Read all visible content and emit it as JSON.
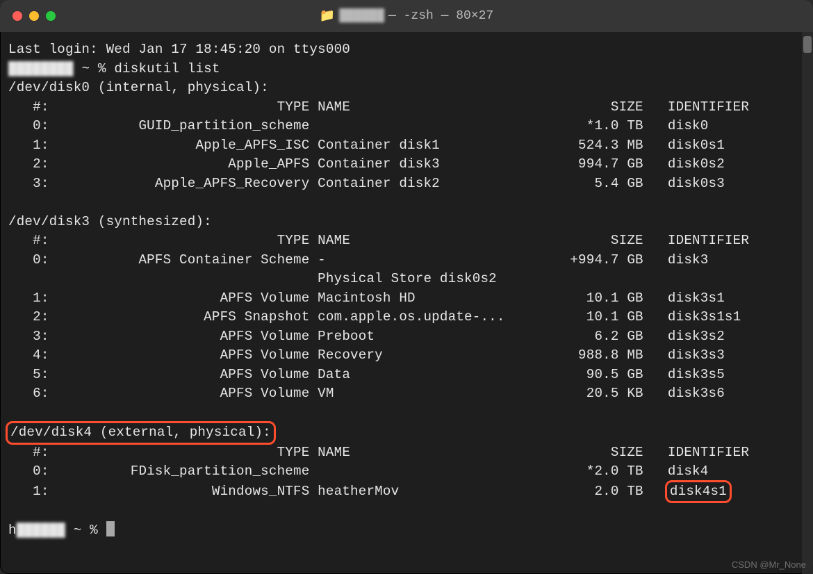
{
  "title": {
    "host_hidden": "██████",
    "suffix": "— -zsh — 80×27"
  },
  "login_line": "Last login: Wed Jan 17 18:45:20 on ttys000",
  "prompt1_user_hidden": "████████",
  "prompt1_path": "~ %",
  "command": "diskutil list",
  "disks": [
    {
      "header": "/dev/disk0 (internal, physical):",
      "highlight": false,
      "cols": {
        "idx": "   #:",
        "type": "TYPE",
        "name": "NAME",
        "size": "SIZE",
        "id": "IDENTIFIER"
      },
      "rows": [
        {
          "idx": "   0:",
          "type": "GUID_partition_scheme",
          "name": "",
          "size": "*1.0 TB",
          "id": "disk0"
        },
        {
          "idx": "   1:",
          "type": "Apple_APFS_ISC",
          "name": "Container disk1",
          "size": "524.3 MB",
          "id": "disk0s1"
        },
        {
          "idx": "   2:",
          "type": "Apple_APFS",
          "name": "Container disk3",
          "size": "994.7 GB",
          "id": "disk0s2"
        },
        {
          "idx": "   3:",
          "type": "Apple_APFS_Recovery",
          "name": "Container disk2",
          "size": "5.4 GB",
          "id": "disk0s3"
        }
      ]
    },
    {
      "header": "/dev/disk3 (synthesized):",
      "highlight": false,
      "cols": {
        "idx": "   #:",
        "type": "TYPE",
        "name": "NAME",
        "size": "SIZE",
        "id": "IDENTIFIER"
      },
      "rows": [
        {
          "idx": "   0:",
          "type": "APFS Container Scheme",
          "name": "-",
          "size": "+994.7 GB",
          "id": "disk3"
        },
        {
          "idx": "",
          "type": "",
          "name": "Physical Store disk0s2",
          "size": "",
          "id": ""
        },
        {
          "idx": "   1:",
          "type": "APFS Volume",
          "name": "Macintosh HD",
          "size": "10.1 GB",
          "id": "disk3s1"
        },
        {
          "idx": "   2:",
          "type": "APFS Snapshot",
          "name": "com.apple.os.update-...",
          "size": "10.1 GB",
          "id": "disk3s1s1"
        },
        {
          "idx": "   3:",
          "type": "APFS Volume",
          "name": "Preboot",
          "size": "6.2 GB",
          "id": "disk3s2"
        },
        {
          "idx": "   4:",
          "type": "APFS Volume",
          "name": "Recovery",
          "size": "988.8 MB",
          "id": "disk3s3"
        },
        {
          "idx": "   5:",
          "type": "APFS Volume",
          "name": "Data",
          "size": "90.5 GB",
          "id": "disk3s5"
        },
        {
          "idx": "   6:",
          "type": "APFS Volume",
          "name": "VM",
          "size": "20.5 KB",
          "id": "disk3s6"
        }
      ]
    },
    {
      "header": "/dev/disk4 (external, physical):",
      "highlight": true,
      "cols": {
        "idx": "   #:",
        "type": "TYPE",
        "name": "NAME",
        "size": "SIZE",
        "id": "IDENTIFIER"
      },
      "rows": [
        {
          "idx": "   0:",
          "type": "FDisk_partition_scheme",
          "name": "",
          "size": "*2.0 TB",
          "id": "disk4"
        },
        {
          "idx": "   1:",
          "type": "Windows_NTFS",
          "name": "heatherMov",
          "size": "2.0 TB",
          "id": "disk4s1",
          "id_highlight": true
        }
      ]
    }
  ],
  "prompt2_user": "h",
  "prompt2_hidden": "██████",
  "prompt2_path": "~ %",
  "watermark": "CSDN @Mr_None"
}
